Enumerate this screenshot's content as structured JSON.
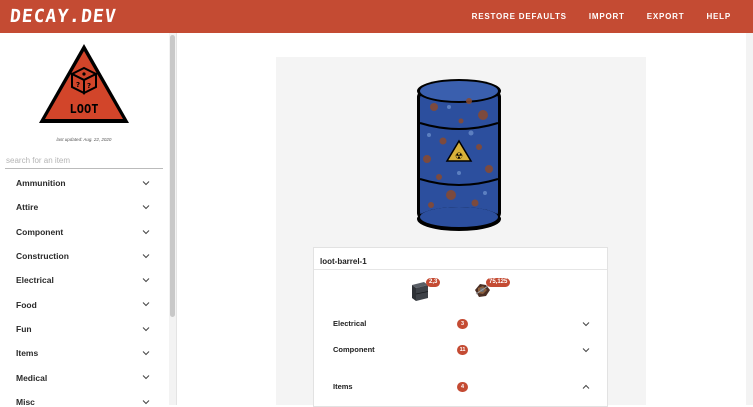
{
  "brand": {
    "name": "DECAY.DEV"
  },
  "nav": {
    "items": [
      "RESTORE DEFAULTS",
      "IMPORT",
      "EXPORT",
      "HELP"
    ]
  },
  "sidebar": {
    "logo_text": "LOOT",
    "last_updated": "last updated: Aug. 22, 2020",
    "search_placeholder": "search for an item",
    "categories": [
      "Ammunition",
      "Attire",
      "Component",
      "Construction",
      "Electrical",
      "Food",
      "Fun",
      "Items",
      "Medical",
      "Misc"
    ]
  },
  "detail": {
    "item_name": "loot-barrel-1",
    "drops": [
      {
        "icon": "crate-icon",
        "badge": "2,3"
      },
      {
        "icon": "scrap-metal-icon",
        "badge": "75,125"
      }
    ],
    "sections": [
      {
        "label": "Electrical",
        "count": "3",
        "expanded": false
      },
      {
        "label": "Component",
        "count": "11",
        "expanded": false
      },
      {
        "label": "Items",
        "count": "4",
        "expanded": true
      }
    ]
  },
  "colors": {
    "accent": "#c44b33",
    "barrel": "#2c4f9e",
    "panel": "#f4f4f4"
  }
}
